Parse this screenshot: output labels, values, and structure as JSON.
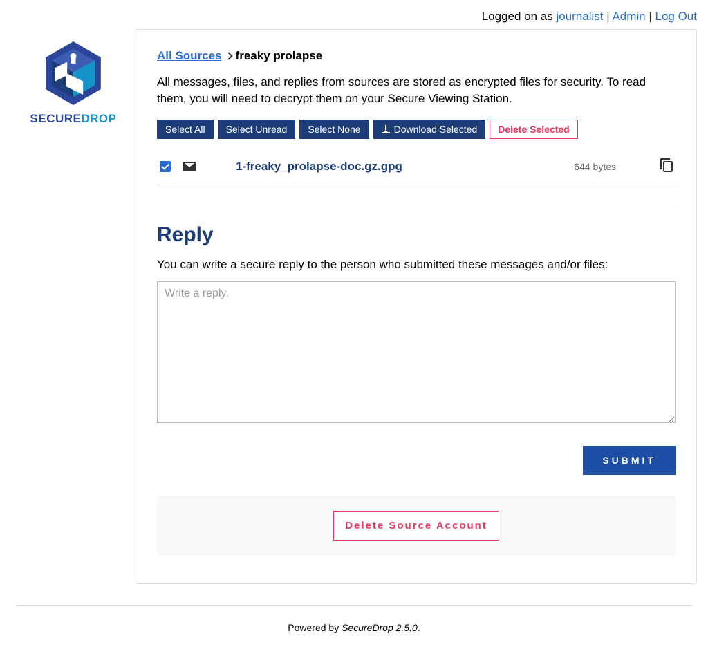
{
  "topbar": {
    "logged_on_as": "Logged on as ",
    "username": "journalist",
    "admin": "Admin",
    "logout": "Log Out"
  },
  "logo": {
    "name1": "SECURE",
    "name2": "DROP"
  },
  "breadcrumb": {
    "all_sources": "All Sources",
    "current": "freaky prolapse"
  },
  "description": "All messages, files, and replies from sources are stored as encrypted files for security. To read them, you will need to decrypt them on your Secure Viewing Station.",
  "buttons": {
    "select_all": "Select All",
    "select_unread": "Select Unread",
    "select_none": "Select None",
    "download_selected": "Download Selected",
    "delete_selected": "Delete Selected"
  },
  "files": [
    {
      "name": "1-freaky_prolapse-doc.gz.gpg",
      "size": "644 bytes",
      "checked": true
    }
  ],
  "reply": {
    "heading": "Reply",
    "desc": "You can write a secure reply to the person who submitted these messages and/or files:",
    "placeholder": "Write a reply.",
    "submit": "SUBMIT"
  },
  "delete_source": "Delete Source Account",
  "footer": {
    "prefix": "Powered by ",
    "product": "SecureDrop 2.5.0",
    "suffix": "."
  }
}
